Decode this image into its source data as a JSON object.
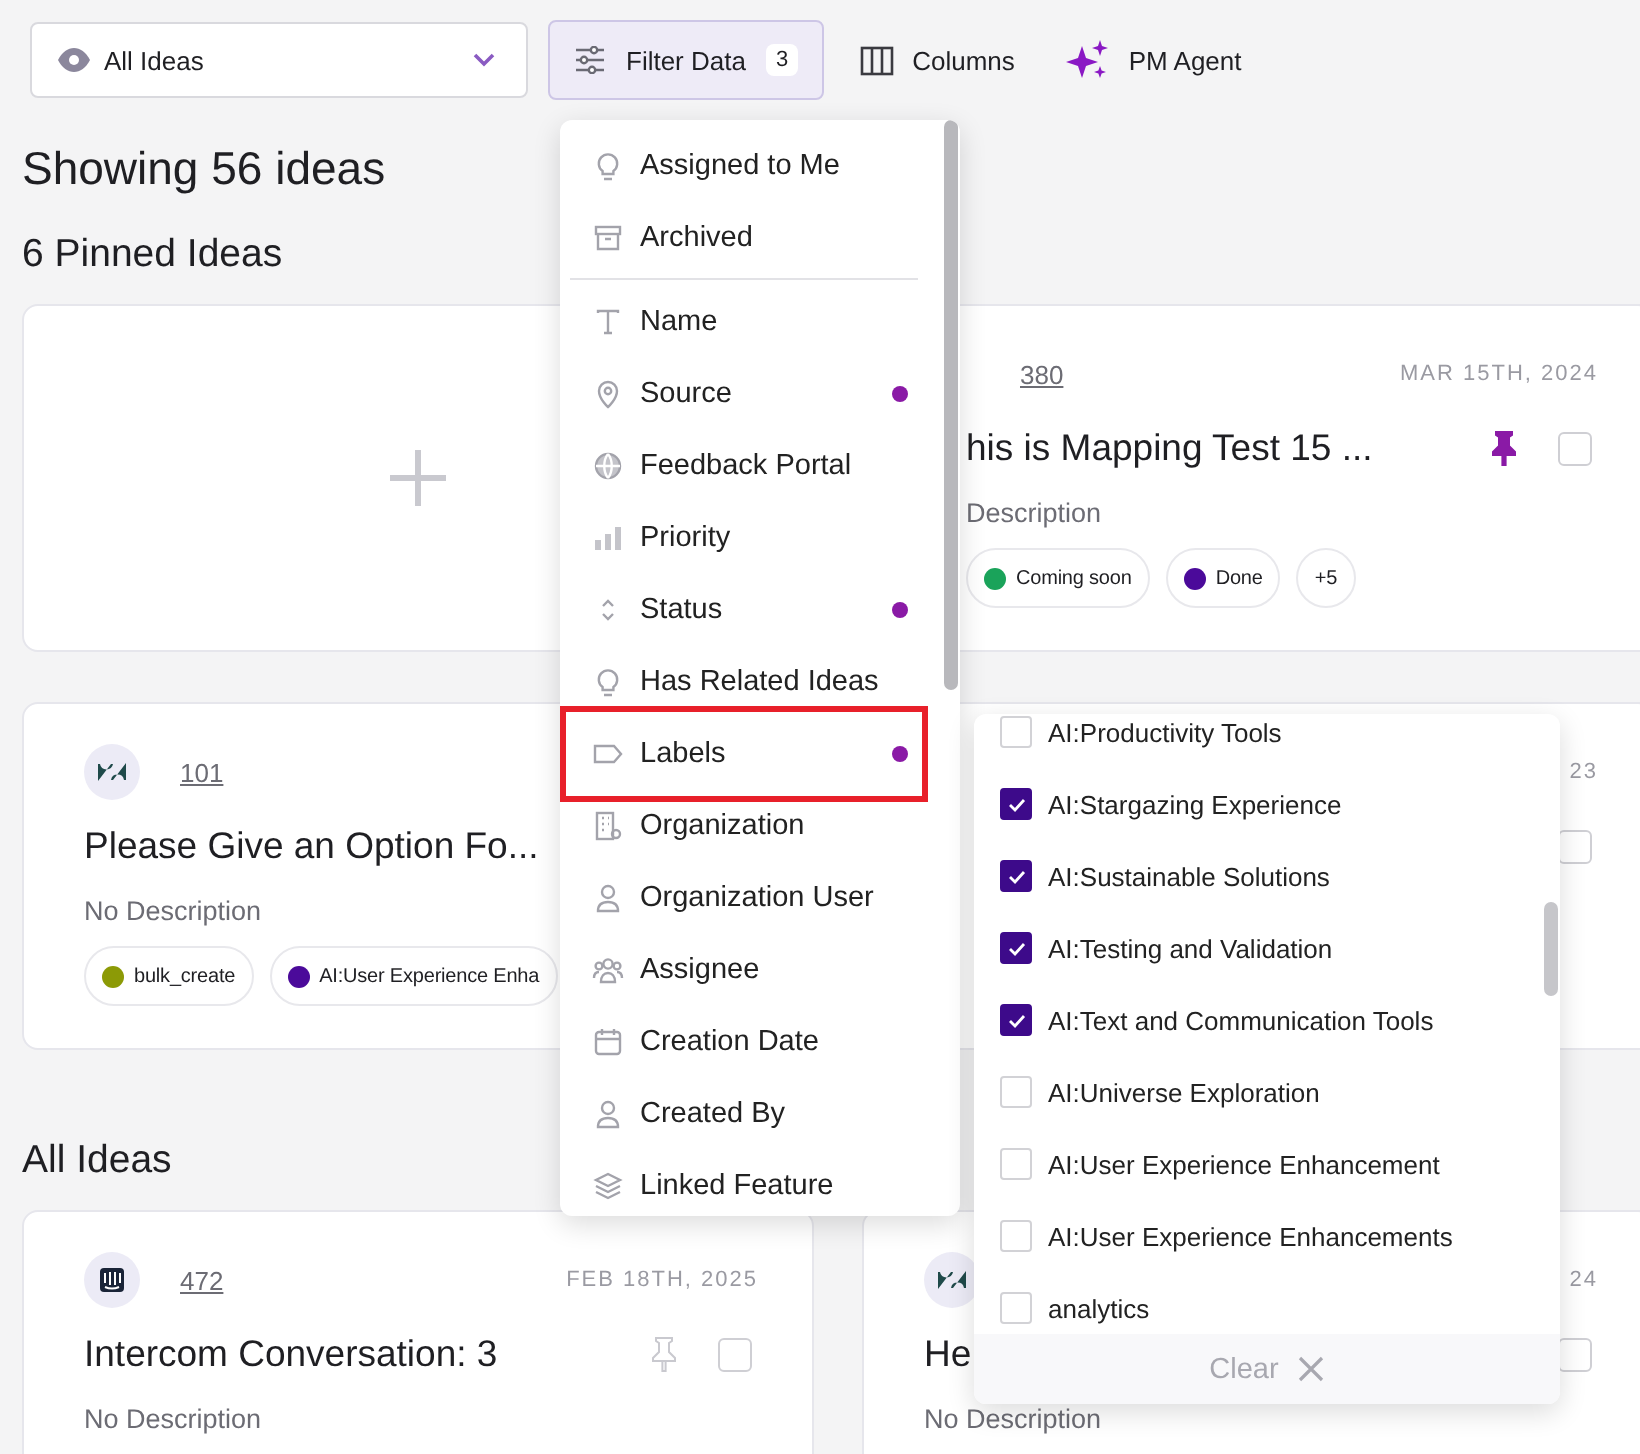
{
  "view_select": {
    "value": "All Ideas"
  },
  "toolbar": {
    "filter_button": {
      "label": "Filter Data",
      "count": "3",
      "active": true
    },
    "columns_button": {
      "label": "Columns"
    },
    "agent_button": {
      "label": "PM Agent"
    }
  },
  "summary": "Showing 56 ideas",
  "pinned_heading": "6 Pinned Ideas",
  "pinned_cards": [
    {
      "kind": "add"
    },
    {
      "kind": "idea",
      "number": "380",
      "date": "MAR 15TH, 2024",
      "title": "his is Mapping Test 15 ...",
      "description": "Description",
      "pinned": true,
      "checked": false,
      "tags": [
        {
          "label": "Coming soon",
          "color": "#1aa35a"
        },
        {
          "label": "Done",
          "color": "#4b0a9a"
        },
        {
          "label": "+5"
        }
      ]
    },
    {
      "kind": "idea",
      "avatar": {
        "kind": "ticket"
      },
      "number": "101",
      "title": "Please Give an Option Fo...",
      "description": "No Description",
      "tags": [
        {
          "label": "bulk_create",
          "color": "#8c9a06"
        },
        {
          "label": "AI:User Experience Enha",
          "color": "#4b0a9a"
        }
      ]
    },
    {
      "kind": "idea",
      "date": "23",
      "checked": false
    }
  ],
  "all_heading": "All Ideas",
  "all_cards": [
    {
      "kind": "idea",
      "avatar": {
        "kind": "chat"
      },
      "number": "472",
      "date": "FEB 18TH, 2025",
      "title": "Intercom Conversation: 3",
      "description": "No Description",
      "pinned": false,
      "checked": false
    },
    {
      "kind": "idea",
      "avatar": {
        "kind": "ticket"
      },
      "date": "24",
      "title": "He",
      "description": "No Description",
      "checked": false
    }
  ],
  "filter_menu": {
    "groups": [
      {
        "items": [
          {
            "label": "Assigned to Me",
            "filtered": false,
            "highlighted": false
          },
          {
            "label": "Archived",
            "filtered": false,
            "highlighted": false
          }
        ]
      },
      {
        "items": [
          {
            "label": "Name",
            "filtered": false,
            "highlighted": false
          },
          {
            "label": "Source",
            "filtered": true,
            "highlighted": false
          },
          {
            "label": "Feedback Portal",
            "filtered": false,
            "highlighted": false
          },
          {
            "label": "Priority",
            "filtered": false,
            "highlighted": false
          },
          {
            "label": "Status",
            "filtered": true,
            "highlighted": false
          },
          {
            "label": "Has Related Ideas",
            "filtered": false,
            "highlighted": false
          },
          {
            "label": "Labels",
            "filtered": true,
            "highlighted": true
          },
          {
            "label": "Organization",
            "filtered": false,
            "highlighted": false
          },
          {
            "label": "Organization User",
            "filtered": false,
            "highlighted": false
          },
          {
            "label": "Assignee",
            "filtered": false,
            "highlighted": false
          },
          {
            "label": "Creation Date",
            "filtered": false,
            "highlighted": false
          },
          {
            "label": "Created By",
            "filtered": false,
            "highlighted": false
          },
          {
            "label": "Linked Feature",
            "filtered": false,
            "highlighted": false
          }
        ]
      }
    ]
  },
  "labels_menu": {
    "options": [
      {
        "label": "AI:Productivity Tools",
        "checked": false
      },
      {
        "label": "AI:Stargazing Experience",
        "checked": true
      },
      {
        "label": "AI:Sustainable Solutions",
        "checked": true
      },
      {
        "label": "AI:Testing and Validation",
        "checked": true
      },
      {
        "label": "AI:Text and Communication Tools",
        "checked": true
      },
      {
        "label": "AI:Universe Exploration",
        "checked": false
      },
      {
        "label": "AI:User Experience Enhancement",
        "checked": false
      },
      {
        "label": "AI:User Experience Enhancements",
        "checked": false
      },
      {
        "label": "analytics",
        "checked": false
      }
    ],
    "clear_button": "Clear"
  }
}
